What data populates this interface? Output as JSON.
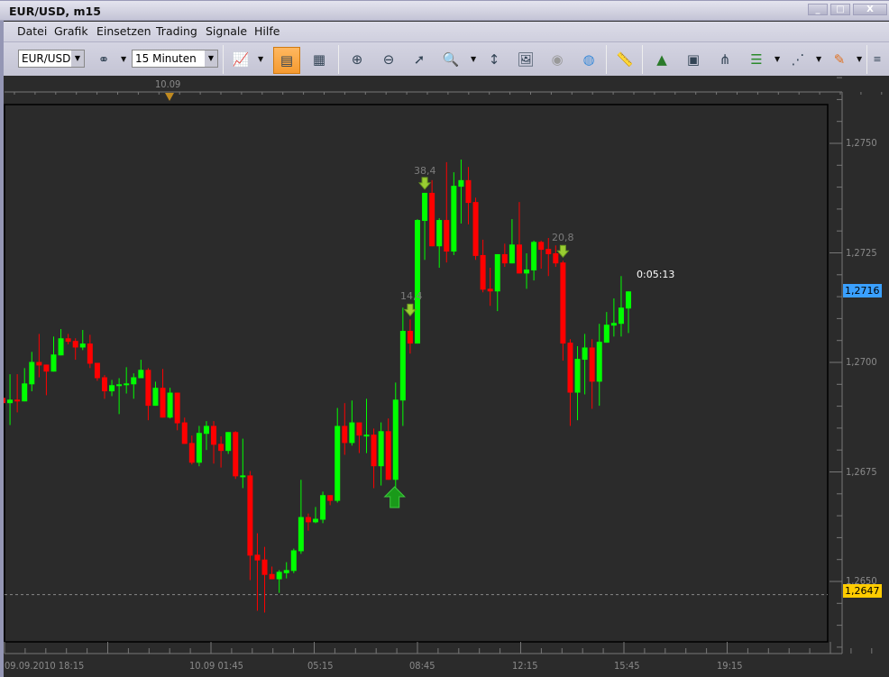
{
  "window": {
    "title": "EUR/USD, m15",
    "minimize": "_",
    "maximize": "□",
    "close": "X"
  },
  "menu": [
    "Datei",
    "Grafik",
    "Einsetzen",
    "Trading",
    "Signale",
    "Hilfe"
  ],
  "toolbar": {
    "symbol": "EUR/USD",
    "timeframe": "15 Minuten",
    "icons": [
      "chart-type-icon",
      "quick-order-icon",
      "market-watch-icon",
      "zoom-in-icon",
      "zoom-out-icon",
      "zoom-cursor-icon",
      "zoom-range-icon",
      "scale-fit-icon",
      "screenshot-icon",
      "eye-icon",
      "globe-icon",
      "ruler-icon",
      "add-image-icon",
      "template-icon",
      "pitchfork-icon",
      "indicator-list-icon",
      "fan-icon",
      "pencil-icon",
      "more-icon"
    ]
  },
  "colors": {
    "bull": "#00ff00",
    "bear": "#ff0000",
    "background": "#2b2b2b",
    "last_price_tag": "#3aa0ff",
    "low_line_tag": "#ffcc00"
  },
  "chart_data": {
    "type": "candlestick",
    "symbol": "EUR/USD",
    "timeframe": "m15",
    "ylim": [
      1.26385,
      1.277
    ],
    "y_ticks": [
      "1,2750",
      "1,2725",
      "1,2700",
      "1,2675",
      "1,2650"
    ],
    "y_tick_values": [
      1.275,
      1.2725,
      1.27,
      1.2675,
      1.265
    ],
    "x_labels": [
      "09.09.2010 18:15",
      "10.09 01:45",
      "05:15",
      "08:45",
      "12:15",
      "15:45",
      "19:15"
    ],
    "date_marker": "10.09",
    "last_price": "1,2716",
    "hline_price": "1,2647",
    "hline_value": 1.2647,
    "countdown": "0:05:13",
    "annotations": [
      {
        "text": "14,4",
        "candle": 56
      },
      {
        "text": "38,4",
        "candle": 58
      },
      {
        "text": "20,8",
        "candle": 77
      }
    ],
    "buy_arrow_candle": 53,
    "candles_ohlc": [
      [
        1.26919,
        1.26919,
        1.26907,
        1.26907
      ],
      [
        1.26907,
        1.26973,
        1.26857,
        1.26915
      ],
      [
        1.26915,
        1.26973,
        1.26886,
        1.26911
      ],
      [
        1.26911,
        1.26987,
        1.26911,
        1.26952
      ],
      [
        1.2695,
        1.27024,
        1.26934,
        1.27001
      ],
      [
        1.27001,
        1.27065,
        1.26966,
        1.26993
      ],
      [
        1.26995,
        1.26995,
        1.26925,
        1.26979
      ],
      [
        1.26979,
        1.27059,
        1.26979,
        1.27018
      ],
      [
        1.27016,
        1.27076,
        1.27016,
        1.27055
      ],
      [
        1.27055,
        1.27065,
        1.27041,
        1.27047
      ],
      [
        1.27049,
        1.27055,
        1.27006,
        1.27034
      ],
      [
        1.27034,
        1.27074,
        1.27028,
        1.27043
      ],
      [
        1.27043,
        1.27063,
        1.26987,
        1.26997
      ],
      [
        1.26999,
        1.26999,
        1.26958,
        1.26964
      ],
      [
        1.26966,
        1.26971,
        1.26917,
        1.26934
      ],
      [
        1.26934,
        1.2696,
        1.26923,
        1.26948
      ],
      [
        1.26946,
        1.26964,
        1.26882,
        1.2695
      ],
      [
        1.26948,
        1.26989,
        1.26929,
        1.26952
      ],
      [
        1.2695,
        1.26975,
        1.26917,
        1.26966
      ],
      [
        1.26964,
        1.27006,
        1.26964,
        1.26983
      ],
      [
        1.26983,
        1.26987,
        1.26868,
        1.26901
      ],
      [
        1.26901,
        1.26956,
        1.26901,
        1.26942
      ],
      [
        1.26942,
        1.26985,
        1.26874,
        1.26874
      ],
      [
        1.26874,
        1.26942,
        1.26872,
        1.26931
      ],
      [
        1.26931,
        1.26931,
        1.26845,
        1.26861
      ],
      [
        1.26863,
        1.26874,
        1.26814,
        1.26814
      ],
      [
        1.26816,
        1.26833,
        1.26767,
        1.26771
      ],
      [
        1.26771,
        1.26855,
        1.26763,
        1.26839
      ],
      [
        1.26837,
        1.26866,
        1.268,
        1.26855
      ],
      [
        1.26855,
        1.26866,
        1.26769,
        1.26812
      ],
      [
        1.26814,
        1.26831,
        1.2676,
        1.26798
      ],
      [
        1.26798,
        1.26841,
        1.26791,
        1.26841
      ],
      [
        1.26841,
        1.26843,
        1.26734,
        1.2674
      ],
      [
        1.2674,
        1.26826,
        1.26713,
        1.26742
      ],
      [
        1.26742,
        1.26752,
        1.26503,
        1.26559
      ],
      [
        1.26561,
        1.2661,
        1.26433,
        1.26548
      ],
      [
        1.2655,
        1.26579,
        1.26429,
        1.26515
      ],
      [
        1.26517,
        1.26534,
        1.26505,
        1.26505
      ],
      [
        1.26505,
        1.26526,
        1.26474,
        1.26522
      ],
      [
        1.26519,
        1.26544,
        1.26507,
        1.26526
      ],
      [
        1.26524,
        1.26575,
        1.26519,
        1.26571
      ],
      [
        1.26569,
        1.26732,
        1.26563,
        1.26647
      ],
      [
        1.26647,
        1.26655,
        1.26616,
        1.26635
      ],
      [
        1.26635,
        1.2667,
        1.26633,
        1.26643
      ],
      [
        1.26641,
        1.26705,
        1.26633,
        1.26697
      ],
      [
        1.26697,
        1.26697,
        1.26674,
        1.26684
      ],
      [
        1.26684,
        1.26896,
        1.2668,
        1.26855
      ],
      [
        1.26855,
        1.26907,
        1.26789,
        1.26816
      ],
      [
        1.26816,
        1.26913,
        1.2681,
        1.26863
      ],
      [
        1.26863,
        1.26863,
        1.26793,
        1.26833
      ],
      [
        1.26833,
        1.26917,
        1.26793,
        1.26835
      ],
      [
        1.26835,
        1.26849,
        1.26713,
        1.26763
      ],
      [
        1.26763,
        1.26863,
        1.26719,
        1.26843
      ],
      [
        1.26843,
        1.26872,
        1.26732,
        1.26732
      ],
      [
        1.26732,
        1.26954,
        1.26703,
        1.26915
      ],
      [
        1.26913,
        1.27125,
        1.26855,
        1.27072
      ],
      [
        1.27072,
        1.27098,
        1.2702,
        1.27043
      ],
      [
        1.27043,
        1.27327,
        1.27043,
        1.27325
      ],
      [
        1.27323,
        1.27387,
        1.27234,
        1.27387
      ],
      [
        1.27387,
        1.27416,
        1.27265,
        1.27265
      ],
      [
        1.27265,
        1.27329,
        1.27216,
        1.27325
      ],
      [
        1.27325,
        1.27457,
        1.27228,
        1.27253
      ],
      [
        1.27253,
        1.27434,
        1.27245,
        1.27403
      ],
      [
        1.27401,
        1.27463,
        1.27317,
        1.27416
      ],
      [
        1.27416,
        1.27446,
        1.27315,
        1.27364
      ],
      [
        1.27366,
        1.27376,
        1.27234,
        1.27243
      ],
      [
        1.27245,
        1.2728,
        1.2716,
        1.27166
      ],
      [
        1.27168,
        1.27216,
        1.27129,
        1.27162
      ],
      [
        1.27162,
        1.27247,
        1.27117,
        1.27247
      ],
      [
        1.27247,
        1.27271,
        1.27218,
        1.27226
      ],
      [
        1.27226,
        1.27327,
        1.27226,
        1.27269
      ],
      [
        1.27269,
        1.27366,
        1.27203,
        1.27203
      ],
      [
        1.27203,
        1.27249,
        1.27168,
        1.27212
      ],
      [
        1.2721,
        1.27278,
        1.27187,
        1.27275
      ],
      [
        1.27275,
        1.27278,
        1.27214,
        1.27257
      ],
      [
        1.27259,
        1.27284,
        1.27197,
        1.27247
      ],
      [
        1.27249,
        1.27267,
        1.27218,
        1.27226
      ],
      [
        1.27228,
        1.27232,
        1.27004,
        1.27043
      ],
      [
        1.27045,
        1.27053,
        1.26855,
        1.26931
      ],
      [
        1.26931,
        1.27037,
        1.26868,
        1.27008
      ],
      [
        1.27006,
        1.27065,
        1.26927,
        1.27034
      ],
      [
        1.27034,
        1.27053,
        1.26894,
        1.26956
      ],
      [
        1.26956,
        1.27088,
        1.26901,
        1.27047
      ],
      [
        1.27045,
        1.27115,
        1.27045,
        1.27086
      ],
      [
        1.27084,
        1.27146,
        1.27059,
        1.2709
      ],
      [
        1.27088,
        1.27197,
        1.27059,
        1.27125
      ],
      [
        1.27123,
        1.27162,
        1.27067,
        1.27162
      ]
    ]
  }
}
